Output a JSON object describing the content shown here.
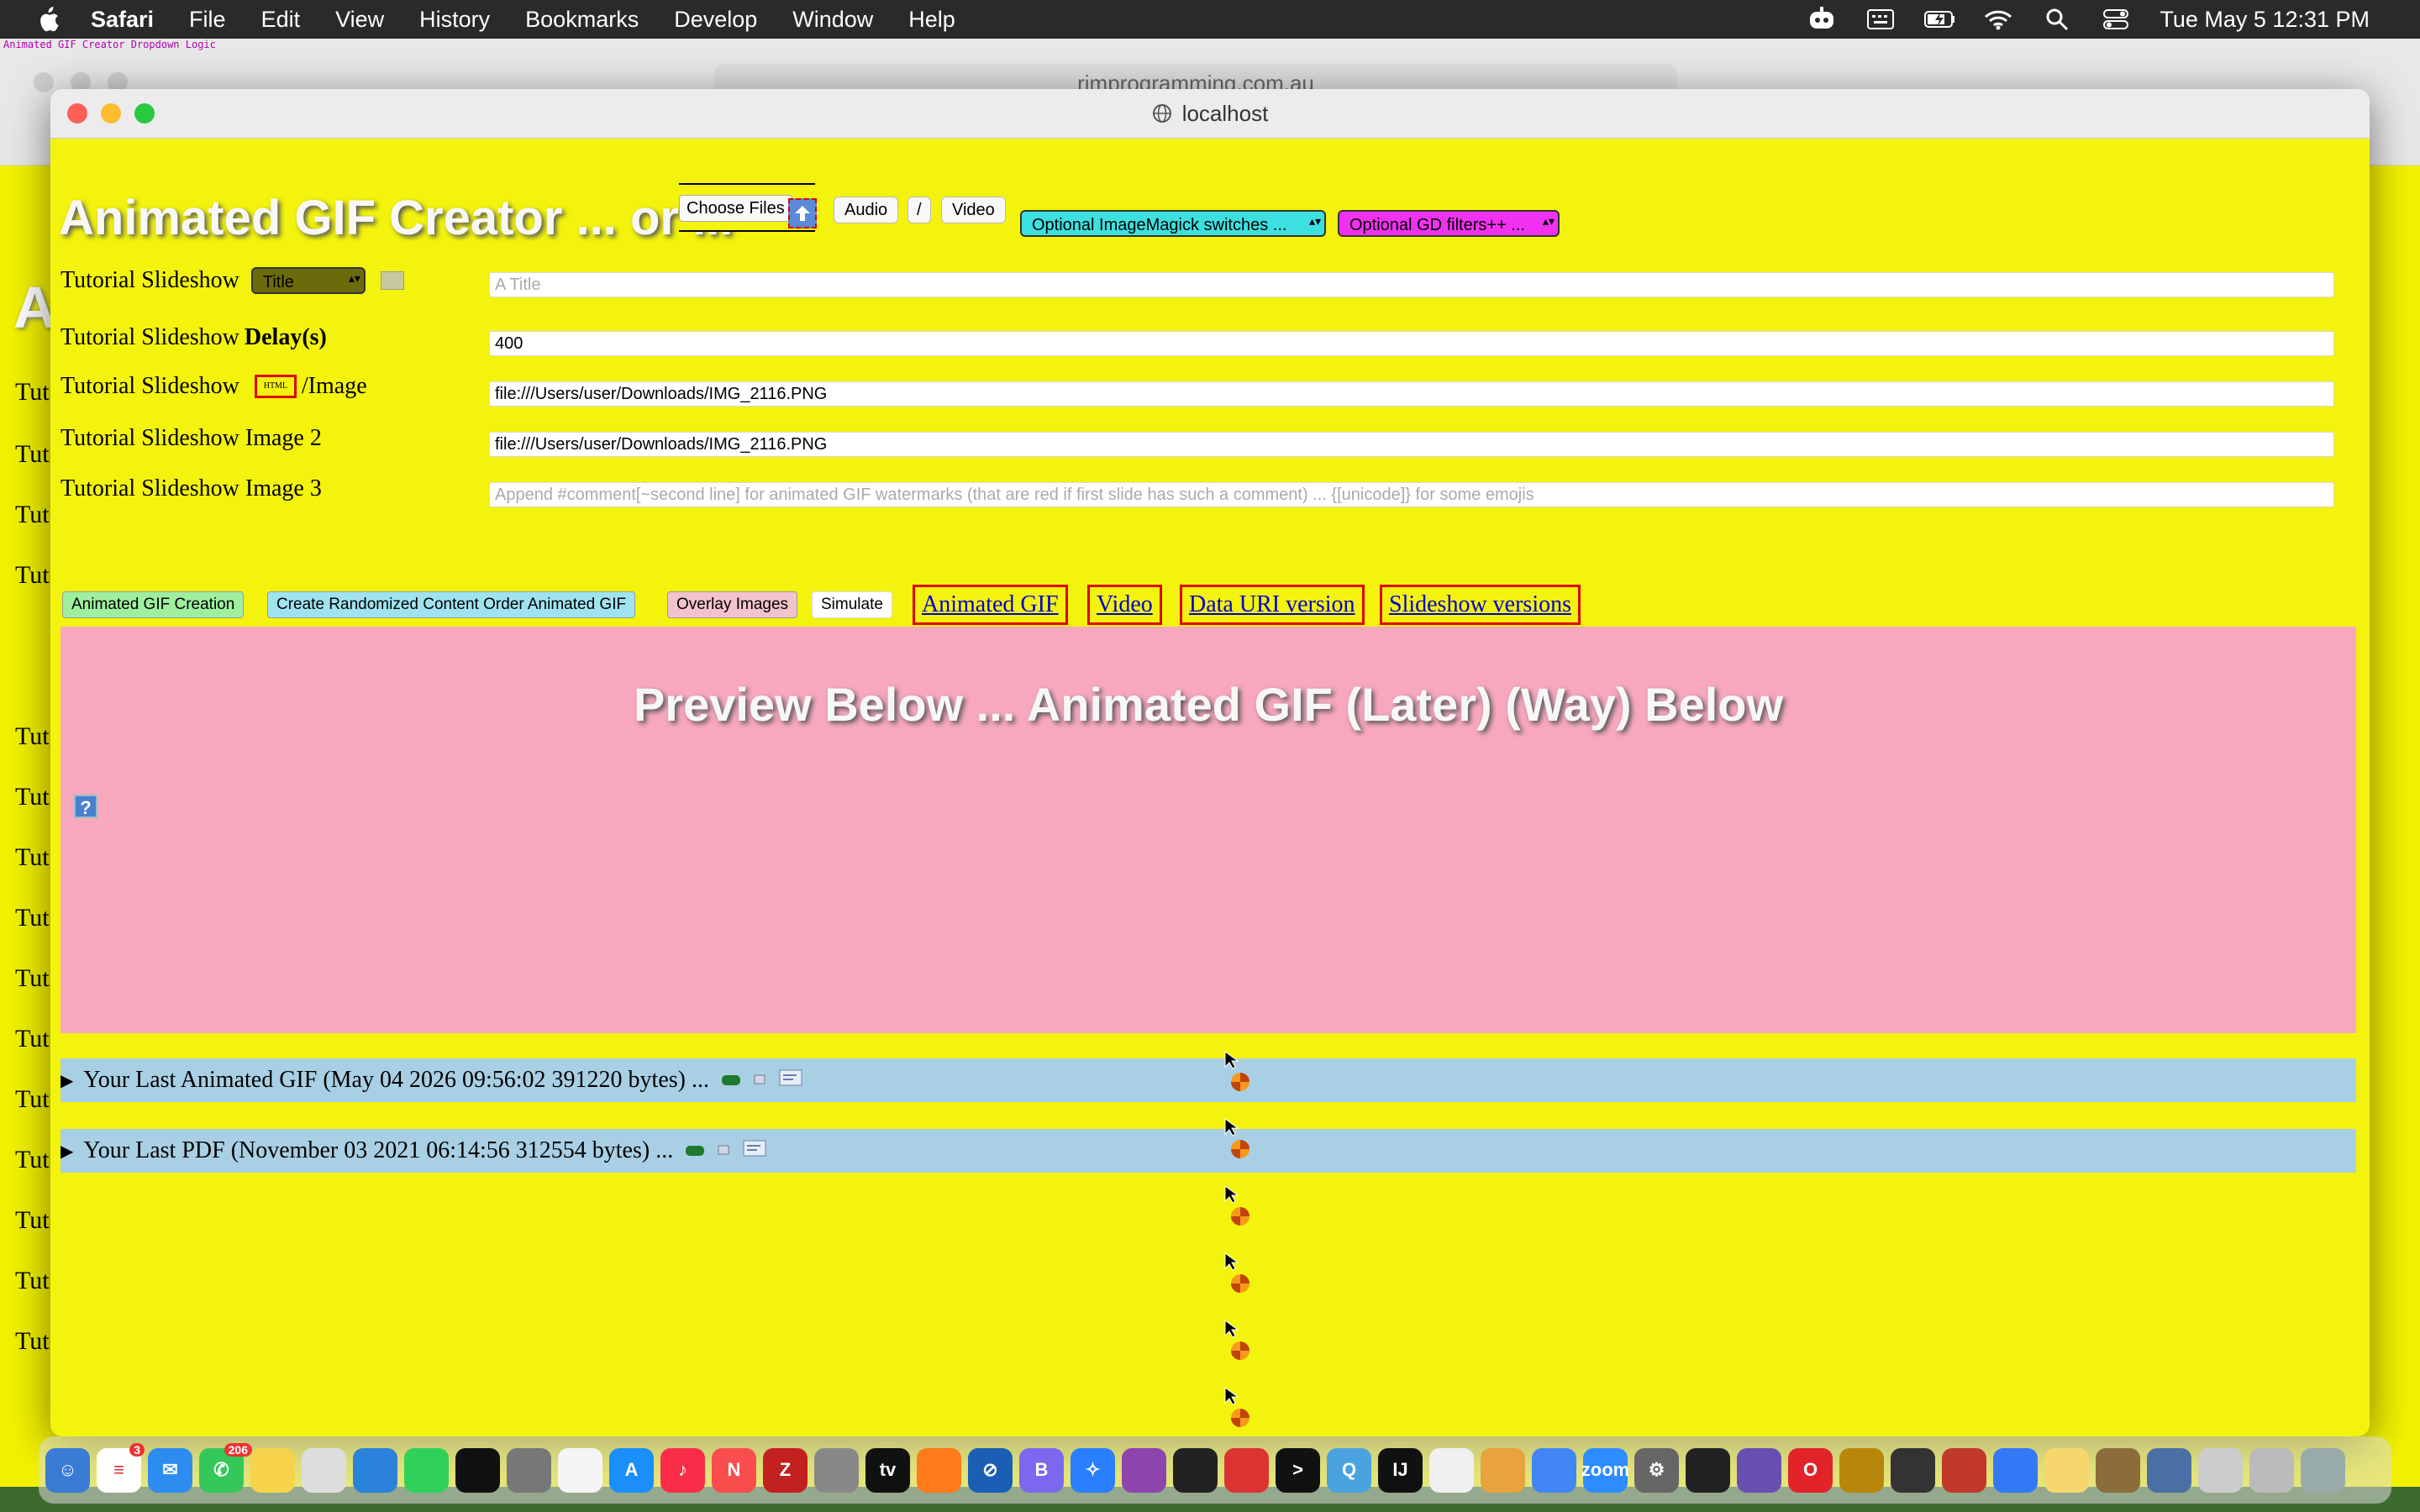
{
  "menubar": {
    "items": [
      {
        "label": "Safari",
        "bold": true
      },
      {
        "label": "File"
      },
      {
        "label": "Edit"
      },
      {
        "label": "View"
      },
      {
        "label": "History"
      },
      {
        "label": "Bookmarks"
      },
      {
        "label": "Develop"
      },
      {
        "label": "Window"
      },
      {
        "label": "Help"
      }
    ],
    "clock": "Tue May 5  12:31 PM"
  },
  "background_window": {
    "url": "rjmprogramming.com.au",
    "tab_title": "Animated GIF Creator Dropdown Logic",
    "left_labels": [
      "Tut",
      "Tut",
      "Tut",
      "Tut",
      "Tut",
      "Tut",
      "Tut",
      "Tut",
      "Tut",
      "Tut",
      "Tut",
      "Tut",
      "Tut",
      "Tut",
      "Tut"
    ],
    "big_letter": "A"
  },
  "window": {
    "title": "localhost"
  },
  "header": {
    "app_title": "Animated GIF Creator ... or ...",
    "choose_files_label": "Choose Files",
    "audio_label": "Audio",
    "slash_label": "/",
    "video_label": "Video",
    "imagemagick_select": "Optional ImageMagick switches ...",
    "gd_select": "Optional GD filters++ ..."
  },
  "form": {
    "row1_label": "Tutorial Slideshow",
    "title_select": "Title",
    "title_placeholder": "A Title",
    "row2_label": "Tutorial Slideshow",
    "row2_bold": "Delay(s)",
    "delay_value": "400",
    "row3_label": "Tutorial Slideshow",
    "row3_html": "HTML",
    "row3_suffix": "/Image",
    "image_value": "file:///Users/user/Downloads/IMG_2116.PNG",
    "row4_label": "Tutorial Slideshow Image 2",
    "image2_value": "file:///Users/user/Downloads/IMG_2116.PNG",
    "row5_label": "Tutorial Slideshow Image 3",
    "image3_placeholder": "Append #comment[~second line] for animated GIF watermarks (that are red if first slide has such a comment) ... {[unicode]} for some emojis"
  },
  "actions": {
    "create_gif": "Animated GIF Creation",
    "create_random": "Create Randomized Content Order Animated GIF",
    "overlay": "Overlay Images",
    "simulate": "Simulate",
    "link_gif": "Animated GIF",
    "link_video": "Video",
    "link_datauri": "Data URI version",
    "link_slideshow": "Slideshow versions"
  },
  "preview": {
    "title": "Preview Below ... Animated GIF (Later) (Way) Below",
    "help": "?"
  },
  "history": {
    "last_gif": "Your Last Animated GIF (May 04 2026 09:56:02 391220 bytes) ...",
    "last_pdf": "Your Last PDF (November 03 2021 06:14:56 312554 bytes) ..."
  },
  "dock": {
    "mail_badge": "3",
    "messages_badge": "206"
  },
  "colors": {
    "page_yellow": "#f3f30d",
    "preview_pink": "#f7a8bd",
    "history_blue": "#a9cfe4",
    "gif_btn": "#9ef09e",
    "random_btn": "#9fe3ef",
    "overlay_btn": "#f2c3cc",
    "imagemagick_select": "#3de0e0",
    "gd_select": "#f032f0",
    "link_red_border": "#dd0000"
  }
}
